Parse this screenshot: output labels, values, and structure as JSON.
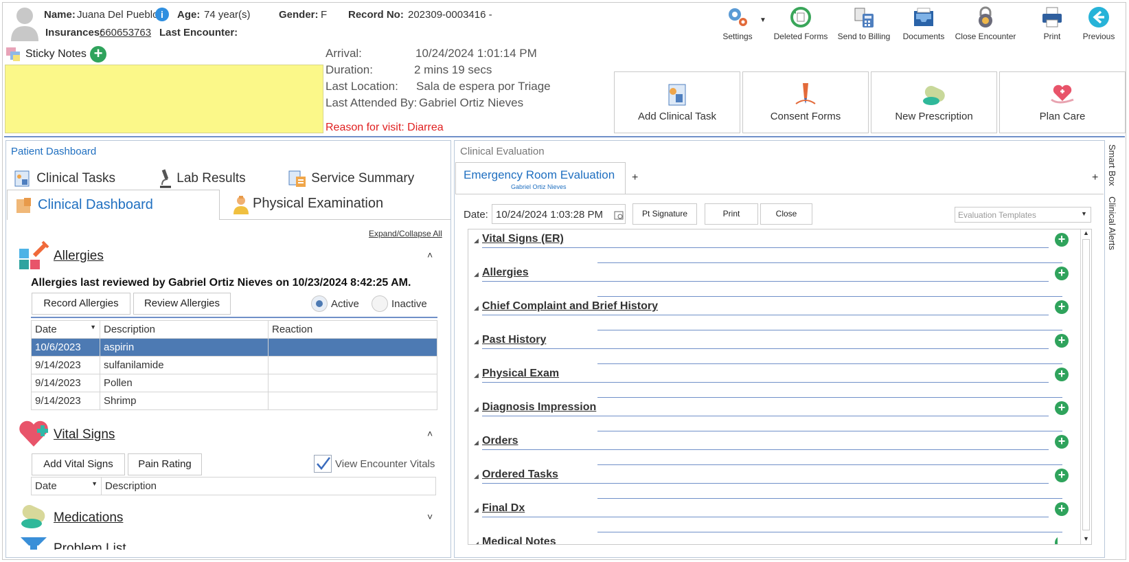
{
  "patient": {
    "name_label": "Name:",
    "name": "Juana Del Pueblo",
    "age_label": "Age:",
    "age": "74 year(s)",
    "gender_label": "Gender:",
    "gender": "F",
    "record_label": "Record No:",
    "record": "202309-0003416 -",
    "insurances_label": "Insurances:",
    "insurance": "660653763",
    "last_encounter_label": "Last Encounter:"
  },
  "toolbar": [
    {
      "label": "Settings",
      "icon": "gears-icon"
    },
    {
      "label": "Deleted Forms",
      "icon": "restore-icon"
    },
    {
      "label": "Send to Billing",
      "icon": "billing-icon"
    },
    {
      "label": "Documents",
      "icon": "inbox-icon"
    },
    {
      "label": "Close Encounter",
      "icon": "lock-icon"
    },
    {
      "label": "Print",
      "icon": "printer-icon"
    },
    {
      "label": "Previous",
      "icon": "back-arrow-icon"
    }
  ],
  "sticky": {
    "label": "Sticky Notes",
    "color": "#fbf889"
  },
  "encounter": {
    "arrival_label": "Arrival:",
    "arrival": "10/24/2024 1:01:14 PM",
    "duration_label": "Duration:",
    "duration": "2 mins 19 secs",
    "location_label": "Last Location:",
    "location": "Sala de espera por Triage",
    "attended_label": "Last Attended By:",
    "attended": "Gabriel Ortiz Nieves",
    "reason": "Reason for visit: Diarrea"
  },
  "actions": [
    "Add Clinical Task",
    "Consent Forms",
    "New Prescription",
    "Plan Care"
  ],
  "dashboard": {
    "title": "Patient Dashboard",
    "tabs": [
      "Clinical Tasks",
      "Lab Results",
      "Service Summary",
      "Clinical Dashboard",
      "Physical Examination"
    ],
    "expand_collapse": "Expand/Collapse All",
    "allergies": {
      "title": "Allergies",
      "reviewed": "Allergies last reviewed by Gabriel Ortiz Nieves on 10/23/2024 8:42:25 AM.",
      "record_btn": "Record Allergies",
      "review_btn": "Review Allergies",
      "active": "Active",
      "inactive": "Inactive",
      "columns": [
        "Date",
        "Description",
        "Reaction"
      ],
      "rows": [
        [
          "10/6/2023",
          "aspirin",
          ""
        ],
        [
          "9/14/2023",
          "sulfanilamide",
          ""
        ],
        [
          "9/14/2023",
          "Pollen",
          ""
        ],
        [
          "9/14/2023",
          "Shrimp",
          ""
        ]
      ]
    },
    "vitals": {
      "title": "Vital Signs",
      "add_btn": "Add Vital Signs",
      "pain_btn": "Pain Rating",
      "view_label": "View Encounter Vitals",
      "columns": [
        "Date",
        "Description"
      ]
    },
    "medications": {
      "title": "Medications"
    },
    "problems": {
      "title": "Problem List"
    }
  },
  "evaluation": {
    "title": "Clinical Evaluation",
    "tab": "Emergency Room Evaluation",
    "tab_sub": "Gabriel Ortiz Nieves",
    "add_tab": "+",
    "date_label": "Date:",
    "date": "10/24/2024 1:03:28 PM",
    "pt_signature": "Pt Signature",
    "print": "Print",
    "close": "Close",
    "templates_placeholder": "Evaluation Templates",
    "sections": [
      "Vital Signs (ER)",
      "Allergies",
      "Chief Complaint and Brief History",
      "Past History",
      "Physical Exam",
      "Diagnosis Impression",
      "Orders",
      "Ordered Tasks",
      "Final Dx",
      "Medical Notes"
    ]
  },
  "side_tabs": [
    "Smart Box",
    "Clinical Alerts"
  ]
}
